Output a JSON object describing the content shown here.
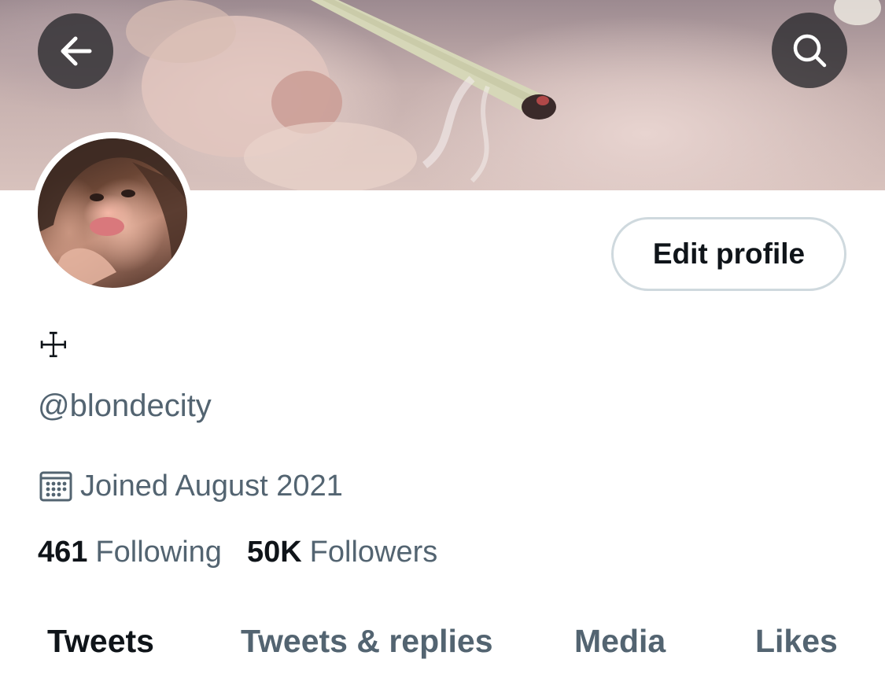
{
  "header": {
    "back_icon": "arrow-left-icon",
    "search_icon": "search-icon"
  },
  "profile": {
    "display_name": "☩",
    "handle": "@blondecity",
    "joined": "Joined August 2021",
    "joined_icon": "calendar-icon",
    "edit_button_label": "Edit profile"
  },
  "stats": {
    "following_count": "461",
    "following_label": "Following",
    "followers_count": "50K",
    "followers_label": "Followers"
  },
  "tabs": [
    {
      "label": "Tweets",
      "active": true
    },
    {
      "label": "Tweets & replies",
      "active": false
    },
    {
      "label": "Media",
      "active": false
    },
    {
      "label": "Likes",
      "active": false
    }
  ],
  "colors": {
    "text_primary": "#0f1419",
    "text_secondary": "#536471",
    "border": "#cfd9de",
    "overlay_button": "#28282c"
  }
}
